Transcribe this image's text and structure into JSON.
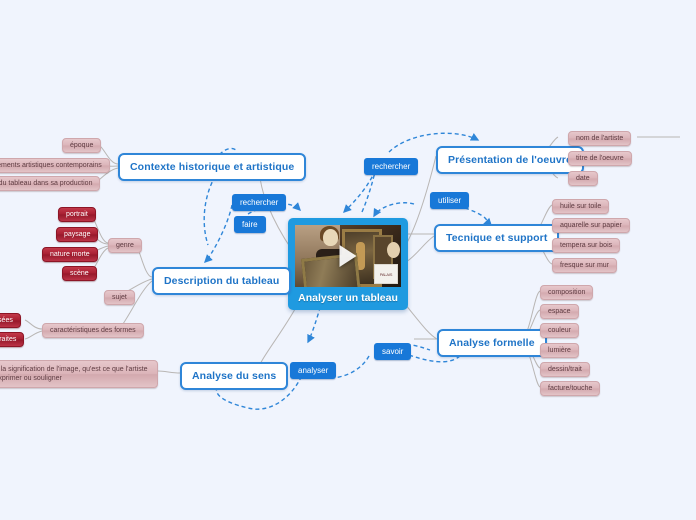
{
  "canvas": {
    "background": "#f0f4fd",
    "accent_blue": "#1878d8",
    "node_border_blue": "#2f86d8",
    "pink_fill": "#dcb5ba",
    "red_fill": "#a81f32",
    "center_fill": "#1f9ae0"
  },
  "center": {
    "label": "Analyser un tableau",
    "thumbnail_icon": "video-thumbnail",
    "play_icon": "play-icon",
    "watermark": "PALAIS"
  },
  "branches": {
    "contexte": {
      "label": "Contexte historique et artistique",
      "children": [
        {
          "label": "époque"
        },
        {
          "label": "mouvements artistiques contemporains"
        },
        {
          "label": "place du tableau dans sa production"
        }
      ]
    },
    "description": {
      "label": "Description du tableau",
      "children": [
        {
          "label": "genre"
        },
        {
          "label": "sujet"
        },
        {
          "label": "caractéristiques des formes"
        }
      ],
      "genre_children": [
        {
          "label": "portrait"
        },
        {
          "label": "paysage"
        },
        {
          "label": "nature morte"
        },
        {
          "label": "scène"
        }
      ],
      "formes_children": [
        {
          "label": "stylisées"
        },
        {
          "label": "abstraites"
        }
      ]
    },
    "sens": {
      "label": "Analyse du sens",
      "note": "Chercher la signification de l'image, qu'est ce que l'artiste a voulu exprimer ou souligner"
    },
    "presentation": {
      "label": "Présentation de l'oeuvre",
      "children": [
        {
          "label": "nom de l'artiste"
        },
        {
          "label": "titre de l'oeuvre"
        },
        {
          "label": "date"
        }
      ]
    },
    "technique": {
      "label": "Tecnique et support",
      "children": [
        {
          "label": "huile sur toile"
        },
        {
          "label": "aquarelle sur papier"
        },
        {
          "label": "tempera sur bois"
        },
        {
          "label": "fresque sur mur"
        }
      ]
    },
    "formelle": {
      "label": "Analyse formelle",
      "children": [
        {
          "label": "composition"
        },
        {
          "label": "espace"
        },
        {
          "label": "couleur"
        },
        {
          "label": "lumière"
        },
        {
          "label": "dessin/trait"
        },
        {
          "label": "facture/touche"
        }
      ]
    }
  },
  "relation_tags": [
    {
      "label": "rechercher",
      "id": "rechercher-left"
    },
    {
      "label": "faire",
      "id": "faire"
    },
    {
      "label": "rechercher",
      "id": "rechercher-top"
    },
    {
      "label": "utiliser",
      "id": "utiliser"
    },
    {
      "label": "savoir",
      "id": "savoir"
    },
    {
      "label": "analyser",
      "id": "analyser"
    }
  ]
}
